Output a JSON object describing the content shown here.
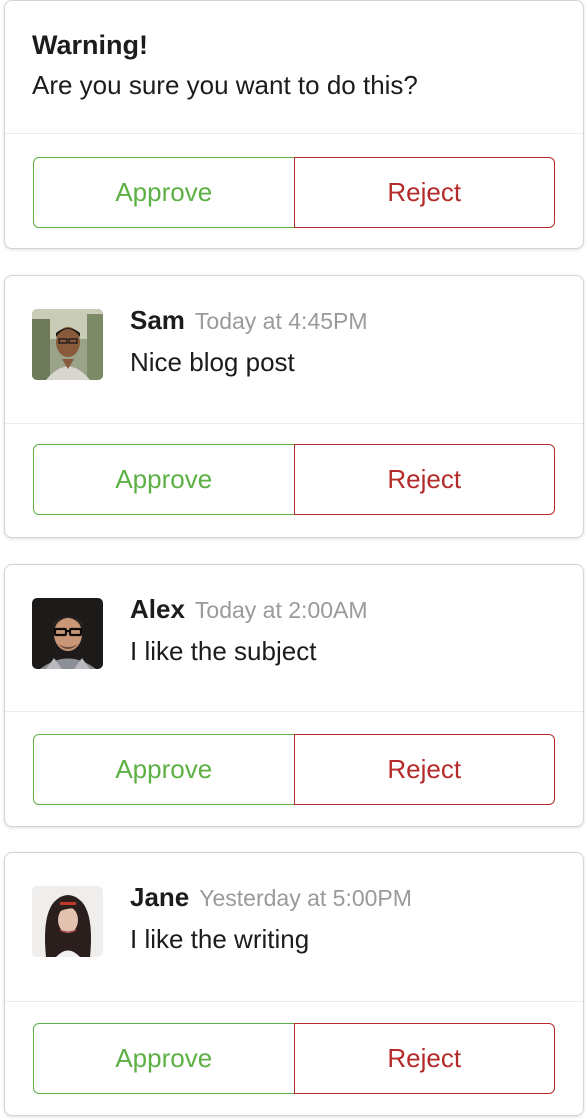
{
  "warning": {
    "header": "Warning!",
    "description": "Are you sure you want to do this?",
    "approve_label": "Approve",
    "reject_label": "Reject"
  },
  "comments": [
    {
      "author": "Sam",
      "meta": "Today at 4:45PM",
      "text": "Nice blog post",
      "approve_label": "Approve",
      "reject_label": "Reject"
    },
    {
      "author": "Alex",
      "meta": "Today at 2:00AM",
      "text": "I like the subject",
      "approve_label": "Approve",
      "reject_label": "Reject"
    },
    {
      "author": "Jane",
      "meta": "Yesterday at 5:00PM",
      "text": "I like the writing",
      "approve_label": "Approve",
      "reject_label": "Reject"
    }
  ],
  "colors": {
    "approve": "#5db046",
    "reject": "#b52b2b",
    "meta": "#9a9a9a"
  }
}
